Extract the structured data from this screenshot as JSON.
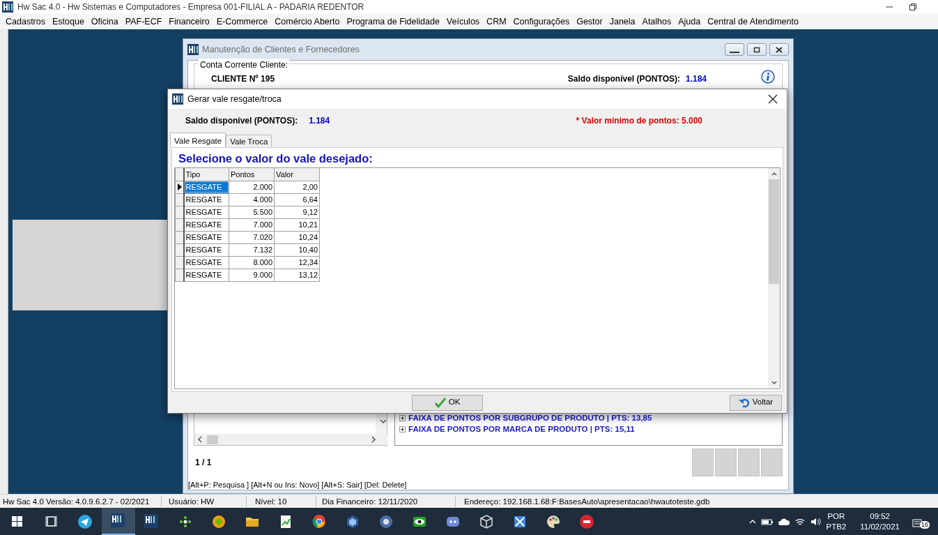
{
  "app": {
    "title": "Hw Sac 4.0 - Hw Sistemas e Computadores - Empresa 001-FILIAL A - PADARIA REDENTOR",
    "menu": [
      "Cadastros",
      "Estoque",
      "Oficina",
      "PAF-ECF",
      "Financeiro",
      "E-Commerce",
      "Comércio Aberto",
      "Programa de Fidelidade",
      "Veículos",
      "CRM",
      "Configurações",
      "Gestor",
      "Janela",
      "Atalhos",
      "Ajuda",
      "Central de Atendimento"
    ]
  },
  "child_window": {
    "title": "Manutenção de Clientes e Fornecedores",
    "active": false,
    "account": {
      "legend": "Conta Corrente Cliente:",
      "client": "CLIENTE Nº 195",
      "balance_label": "Saldo disponível (PONTOS):",
      "balance_value": "1.184"
    },
    "tree": [
      {
        "label": "FAIXA DE PONTOS POR SUBGRUPO DE PRODUTO | PTS: 13,85",
        "expanded": false
      },
      {
        "label": "FAIXA DE PONTOS POR MARCA DE PRODUTO | PTS: 15,11",
        "expanded": false
      }
    ],
    "pager": "1 / 1",
    "shortcuts": "[Alt+P: Pesquisa ]  [Alt+N ou Ins: Novo]  [Alt+S: Sair]  [Del: Delete]"
  },
  "dialog": {
    "title": "Gerar vale resgate/troca",
    "balance_label": "Saldo disponível (PONTOS):",
    "balance_value": "1.184",
    "minimum_note": "* Valor mínimo de pontos: 5.000",
    "tabs": [
      {
        "label": "Vale Resgate",
        "selected": true
      },
      {
        "label": "Vale Troca",
        "selected": false
      }
    ],
    "heading": "Selecione o valor do vale desejado:",
    "table": {
      "columns": [
        "Tipo",
        "Pontos",
        "Valor"
      ],
      "rows": [
        {
          "cells": [
            "RESGATE",
            "2.000",
            "2,00"
          ],
          "selected": true
        },
        {
          "cells": [
            "RESGATE",
            "4.000",
            "6,64"
          ],
          "selected": false
        },
        {
          "cells": [
            "RESGATE",
            "5.500",
            "9,12"
          ],
          "selected": false
        },
        {
          "cells": [
            "RESGATE",
            "7.000",
            "10,21"
          ],
          "selected": false
        },
        {
          "cells": [
            "RESGATE",
            "7.020",
            "10,24"
          ],
          "selected": false
        },
        {
          "cells": [
            "RESGATE",
            "7.132",
            "10,40"
          ],
          "selected": false
        },
        {
          "cells": [
            "RESGATE",
            "8.000",
            "12,34"
          ],
          "selected": false
        },
        {
          "cells": [
            "RESGATE",
            "9.000",
            "13,12"
          ],
          "selected": false
        }
      ]
    },
    "buttons": [
      {
        "label": "OK",
        "kind": "ok"
      },
      {
        "label": "Voltar",
        "kind": "back"
      }
    ]
  },
  "status_bar": [
    "Hw Sac 4.0 Versão: 4.0.9.6.2.7 - 02/2021",
    "Usuário: HW",
    "Nível: 10",
    "Dia Financeiro: 12/11/2020",
    "Endereço: 192.168.1.68:F:BasesAuto\\apresentacao\\hwautoteste.gdb"
  ],
  "taskbar": {
    "language": "POR",
    "keyboard": "PTB2",
    "time": "09:52",
    "date": "11/02/2021",
    "notifications": "16"
  }
}
